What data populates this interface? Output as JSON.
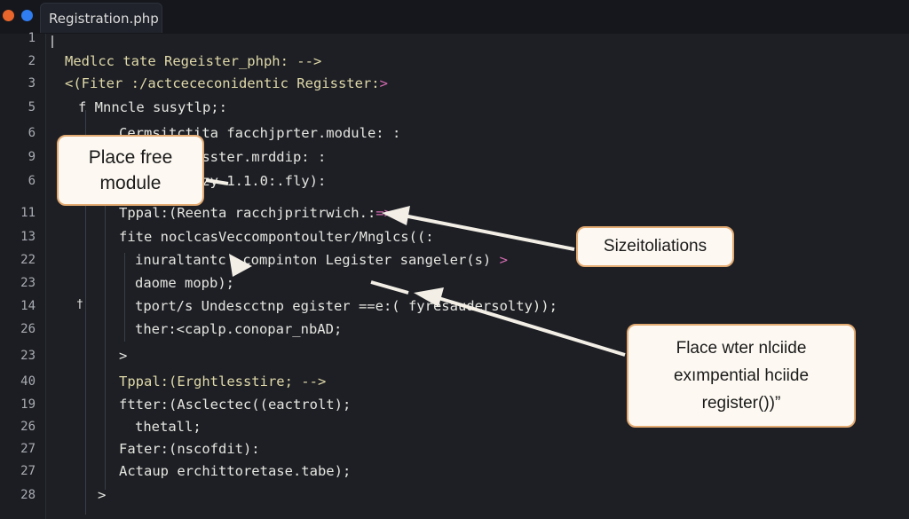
{
  "window": {
    "tab_title": "Registration.php"
  },
  "line_numbers": [
    "1",
    "2",
    "3",
    "5",
    "6",
    "9",
    "6",
    "11",
    "13",
    "22",
    "23",
    "14",
    "26",
    "23",
    "40",
    "19",
    "26",
    "27",
    "27",
    "28"
  ],
  "code_lines": [
    {
      "text": "",
      "color": "w"
    },
    {
      "text": "Medlcc tate Regeister_phph: -->",
      "color": "y"
    },
    {
      "text": "<(Fiter :/actcececonidentic Regisster:",
      "color": "y",
      "suffix": ">"
    },
    {
      "text": "f Mnncle susytlp;:",
      "color": "w"
    },
    {
      "text": "Cermsitctita facchjprter.module: :",
      "color": "w"
    },
    {
      "text": "neestPvctlsster.mrddip: :",
      "color": "w"
    },
    {
      "text": "gple-=e.tazy 1.1.0:.fly):",
      "color": "w"
    },
    {
      "text": "Tppal:(Reenta racchjpritrwich.:",
      "color": "w",
      "suffix": "=>"
    },
    {
      "text": "fite noclcasVeccompontoulter/Mnglcs((:",
      "color": "w"
    },
    {
      "text": "inuraltantc  compinton Legister sangeler(s)",
      "color": "w",
      "suffix": " >"
    },
    {
      "text": "daome mopb);",
      "color": "w"
    },
    {
      "text": "tport/s Undescctnp egister ==e:( fyresaudersolty));",
      "color": "w"
    },
    {
      "text": "ther:<caplp.conopar_nbAD;",
      "color": "w"
    },
    {
      "text": ">",
      "color": "w"
    },
    {
      "text": "Tppal:(Erghtlesstire; -->",
      "color": "y"
    },
    {
      "text": "ftter:(Asclectec((eactrolt);",
      "color": "w"
    },
    {
      "text": "thetall;",
      "color": "w"
    },
    {
      "text": "Fater:(nscofdit):",
      "color": "w"
    },
    {
      "text": "Actaup erchittoretase.tabe);",
      "color": "w"
    },
    {
      "text": ">",
      "color": "w"
    }
  ],
  "gutter_marks": {
    "line14": "†",
    "line3_prefix": "<"
  },
  "callouts": {
    "place_free_module": "Place free\nmodule",
    "sizeitoliations": "Sizeitoliations",
    "place_wter": "Flace wter nlciide\nexımpential hciide\nregister())”"
  },
  "colors": {
    "background": "#1d1f25",
    "callout_border": "#e3aa72",
    "callout_fill": "#fdf9f2",
    "arrow": "#f3efe6",
    "keyword_yellow": "#e0d9a8",
    "accent_pink": "#d46bb0"
  }
}
